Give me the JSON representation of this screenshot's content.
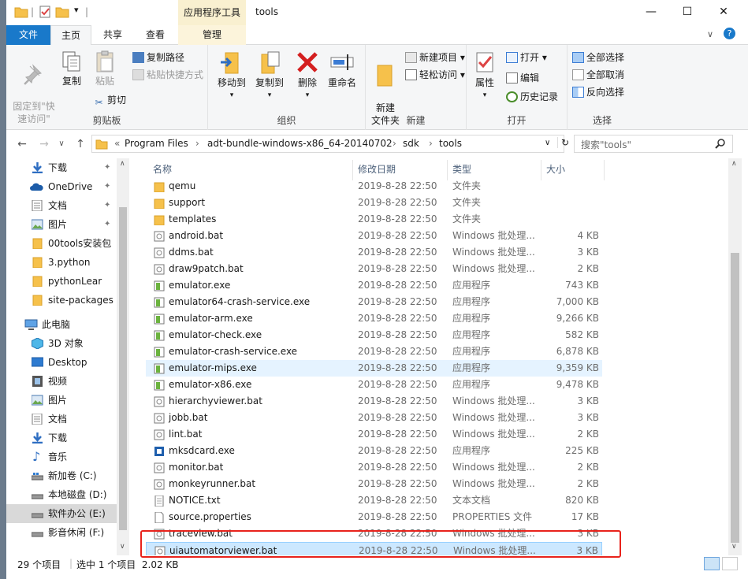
{
  "window": {
    "title": "tools",
    "context_tool": "应用程序工具",
    "minimize": "—",
    "maximize": "☐",
    "close": "✕"
  },
  "tabs": {
    "file": "文件",
    "home": "主页",
    "share": "共享",
    "view": "查看",
    "manage": "管理"
  },
  "ribbon": {
    "clipboard": {
      "label": "剪贴板",
      "pin": "固定到\"快\n速访问\"",
      "copy": "复制",
      "paste": "粘贴",
      "copy_path": "复制路径",
      "paste_shortcut": "粘贴快捷方式",
      "cut": "剪切"
    },
    "organize": {
      "label": "组织",
      "move_to": "移动到",
      "copy_to": "复制到",
      "delete": "删除",
      "rename": "重命名"
    },
    "new": {
      "label": "新建",
      "new_folder": "新建\n文件夹",
      "new_item": "新建项目 ▾",
      "easy_access": "轻松访问 ▾"
    },
    "open": {
      "label": "打开",
      "properties": "属性",
      "open": "打开 ▾",
      "edit": "编辑",
      "history": "历史记录"
    },
    "select": {
      "label": "选择",
      "select_all": "全部选择",
      "select_none": "全部取消",
      "invert": "反向选择"
    }
  },
  "address": {
    "sep": "«",
    "crumbs": [
      "Program Files",
      "adt-bundle-windows-x86_64-20140702",
      "sdk",
      "tools"
    ],
    "search_placeholder": "搜索\"tools\""
  },
  "nav": {
    "quick": [
      {
        "label": "下载",
        "pinned": "true"
      },
      {
        "label": "OneDrive",
        "pinned": "true"
      },
      {
        "label": "文档",
        "pinned": "true"
      },
      {
        "label": "图片",
        "pinned": "true"
      },
      {
        "label": "00tools安装包"
      },
      {
        "label": "3.python"
      },
      {
        "label": "pythonLear"
      },
      {
        "label": "site-packages"
      }
    ],
    "pc_label": "此电脑",
    "pc": [
      {
        "label": "3D 对象"
      },
      {
        "label": "Desktop"
      },
      {
        "label": "视频"
      },
      {
        "label": "图片"
      },
      {
        "label": "文档"
      },
      {
        "label": "下载"
      },
      {
        "label": "音乐"
      },
      {
        "label": "新加卷 (C:)"
      },
      {
        "label": "本地磁盘 (D:)"
      },
      {
        "label": "软件办公 (E:)"
      },
      {
        "label": "影音休闲 (F:)"
      }
    ]
  },
  "columns": {
    "name": "名称",
    "date": "修改日期",
    "type": "类型",
    "size": "大小"
  },
  "files": [
    {
      "name": "qemu",
      "date": "2019-8-28 22:50",
      "type": "文件夹",
      "size": "",
      "icon": "folder"
    },
    {
      "name": "support",
      "date": "2019-8-28 22:50",
      "type": "文件夹",
      "size": "",
      "icon": "folder"
    },
    {
      "name": "templates",
      "date": "2019-8-28 22:50",
      "type": "文件夹",
      "size": "",
      "icon": "folder"
    },
    {
      "name": "android.bat",
      "date": "2019-8-28 22:50",
      "type": "Windows 批处理...",
      "size": "4 KB",
      "icon": "bat"
    },
    {
      "name": "ddms.bat",
      "date": "2019-8-28 22:50",
      "type": "Windows 批处理...",
      "size": "3 KB",
      "icon": "bat"
    },
    {
      "name": "draw9patch.bat",
      "date": "2019-8-28 22:50",
      "type": "Windows 批处理...",
      "size": "2 KB",
      "icon": "bat"
    },
    {
      "name": "emulator.exe",
      "date": "2019-8-28 22:50",
      "type": "应用程序",
      "size": "743 KB",
      "icon": "exe"
    },
    {
      "name": "emulator64-crash-service.exe",
      "date": "2019-8-28 22:50",
      "type": "应用程序",
      "size": "7,000 KB",
      "icon": "exe"
    },
    {
      "name": "emulator-arm.exe",
      "date": "2019-8-28 22:50",
      "type": "应用程序",
      "size": "9,266 KB",
      "icon": "exe"
    },
    {
      "name": "emulator-check.exe",
      "date": "2019-8-28 22:50",
      "type": "应用程序",
      "size": "582 KB",
      "icon": "exe"
    },
    {
      "name": "emulator-crash-service.exe",
      "date": "2019-8-28 22:50",
      "type": "应用程序",
      "size": "6,878 KB",
      "icon": "exe"
    },
    {
      "name": "emulator-mips.exe",
      "date": "2019-8-28 22:50",
      "type": "应用程序",
      "size": "9,359 KB",
      "icon": "exe",
      "hover": true
    },
    {
      "name": "emulator-x86.exe",
      "date": "2019-8-28 22:50",
      "type": "应用程序",
      "size": "9,478 KB",
      "icon": "exe"
    },
    {
      "name": "hierarchyviewer.bat",
      "date": "2019-8-28 22:50",
      "type": "Windows 批处理...",
      "size": "3 KB",
      "icon": "bat"
    },
    {
      "name": "jobb.bat",
      "date": "2019-8-28 22:50",
      "type": "Windows 批处理...",
      "size": "3 KB",
      "icon": "bat"
    },
    {
      "name": "lint.bat",
      "date": "2019-8-28 22:50",
      "type": "Windows 批处理...",
      "size": "2 KB",
      "icon": "bat"
    },
    {
      "name": "mksdcard.exe",
      "date": "2019-8-28 22:50",
      "type": "应用程序",
      "size": "225 KB",
      "icon": "exe2"
    },
    {
      "name": "monitor.bat",
      "date": "2019-8-28 22:50",
      "type": "Windows 批处理...",
      "size": "2 KB",
      "icon": "bat"
    },
    {
      "name": "monkeyrunner.bat",
      "date": "2019-8-28 22:50",
      "type": "Windows 批处理...",
      "size": "2 KB",
      "icon": "bat"
    },
    {
      "name": "NOTICE.txt",
      "date": "2019-8-28 22:50",
      "type": "文本文档",
      "size": "820 KB",
      "icon": "txt"
    },
    {
      "name": "source.properties",
      "date": "2019-8-28 22:50",
      "type": "PROPERTIES 文件",
      "size": "17 KB",
      "icon": "file"
    },
    {
      "name": "traceview.bat",
      "date": "2019-8-28 22:50",
      "type": "Windows 批处理...",
      "size": "3 KB",
      "icon": "bat"
    },
    {
      "name": "uiautomatorviewer.bat",
      "date": "2019-8-28 22:50",
      "type": "Windows 批处理...",
      "size": "3 KB",
      "icon": "bat",
      "selected": true
    }
  ],
  "status": {
    "count": "29 个项目",
    "selected": "选中 1 个项目  2.02 KB"
  },
  "colors": {
    "accent": "#1979ca",
    "selected_row": "#cce8ff",
    "hover_row": "#e5f3ff",
    "highlight": "#e8231c"
  }
}
